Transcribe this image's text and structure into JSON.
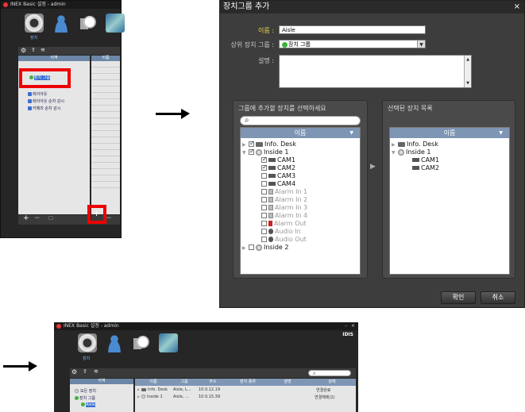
{
  "window_top_left": {
    "title": "INEX Basic 설정 - admin",
    "tab_label": "장치",
    "tree_header": "지역",
    "list_header": "이름",
    "tree_items": [
      "장치 그룹",
      "레이아웃",
      "레이아웃 순차 감시",
      "카메라 순차 감시"
    ]
  },
  "dialog": {
    "title": "장치그룹 추가",
    "close_glyph": "×",
    "name_label": "이름 :",
    "name_value": "Aisle",
    "parent_label": "상위 장치 그룹 :",
    "parent_value": "장치 그룹",
    "description_label": "설명 :",
    "select_group_title": "그룹에 추가할 장치를 선택하세요",
    "selected_group_title": "선택된 장치 목록",
    "list_header": "이름",
    "source_tree": [
      {
        "label": "Info. Desk",
        "checked": true
      },
      {
        "label": "Inside 1",
        "checked": true
      },
      {
        "label": "CAM1",
        "checked": true
      },
      {
        "label": "CAM2",
        "checked": true
      },
      {
        "label": "CAM3",
        "checked": false
      },
      {
        "label": "CAM4",
        "checked": false
      },
      {
        "label": "Alarm In 1",
        "checked": false
      },
      {
        "label": "Alarm In 2",
        "checked": false
      },
      {
        "label": "Alarm In 3",
        "checked": false
      },
      {
        "label": "Alarm In 4",
        "checked": false
      },
      {
        "label": "Alarm Out",
        "checked": false
      },
      {
        "label": "Audio In",
        "checked": false
      },
      {
        "label": "Audio Out",
        "checked": false
      },
      {
        "label": "Inside 2",
        "checked": false
      }
    ],
    "selected_tree": [
      "Info. Desk",
      "Inside 1",
      "CAM1",
      "CAM2"
    ],
    "ok_label": "확인",
    "cancel_label": "취소"
  },
  "window_bottom": {
    "title": "INEX Basic 설정 - admin",
    "brand": "IDIS",
    "tab_label": "장치",
    "tree_header": "지역",
    "tree_items": [
      "모든 장치",
      "장치 그룹",
      "Aisle"
    ],
    "columns": [
      "이름",
      "그룹",
      "주소",
      "장치 종류",
      "설명",
      "상태"
    ],
    "rows": [
      {
        "name": "Info. Desk",
        "group": "Aisle, L...",
        "address": "10.0.12.19",
        "status": "연결완료"
      },
      {
        "name": "Inside 1",
        "group": "Aisle, ...",
        "address": "10.0.15.39",
        "status": "연결해제(2)"
      }
    ]
  },
  "colors": {
    "highlight_red": "#ef0000",
    "header_blue": "#7e96b4",
    "label_yellow": "#f0d84b",
    "group_green": "#3bb33b"
  }
}
